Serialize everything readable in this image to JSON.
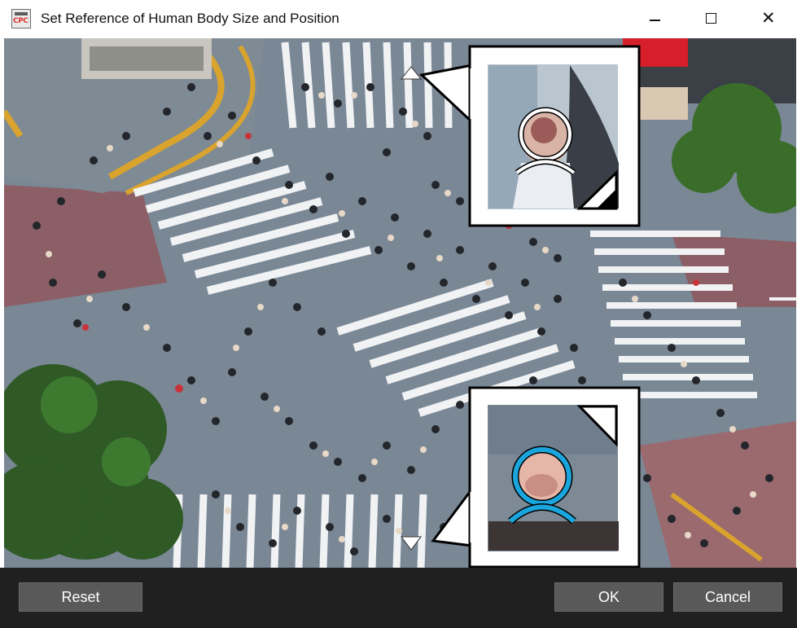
{
  "window": {
    "title": "Set Reference of Human Body Size and Position",
    "app_icon_text": "CPC",
    "controls": {
      "minimize": "—",
      "maximize": "☐",
      "close": "✕"
    }
  },
  "callouts": {
    "top": {
      "marker": "head-marker-white",
      "icon": "head-outline-icon"
    },
    "bottom": {
      "marker": "head-marker-blue",
      "icon": "head-outline-icon",
      "accent": "#1aa6dc"
    }
  },
  "buttons": {
    "reset": "Reset",
    "ok": "OK",
    "cancel": "Cancel"
  },
  "colors": {
    "bottom_bar": "#202020",
    "button": "#595959",
    "accent": "#1aa6dc"
  }
}
